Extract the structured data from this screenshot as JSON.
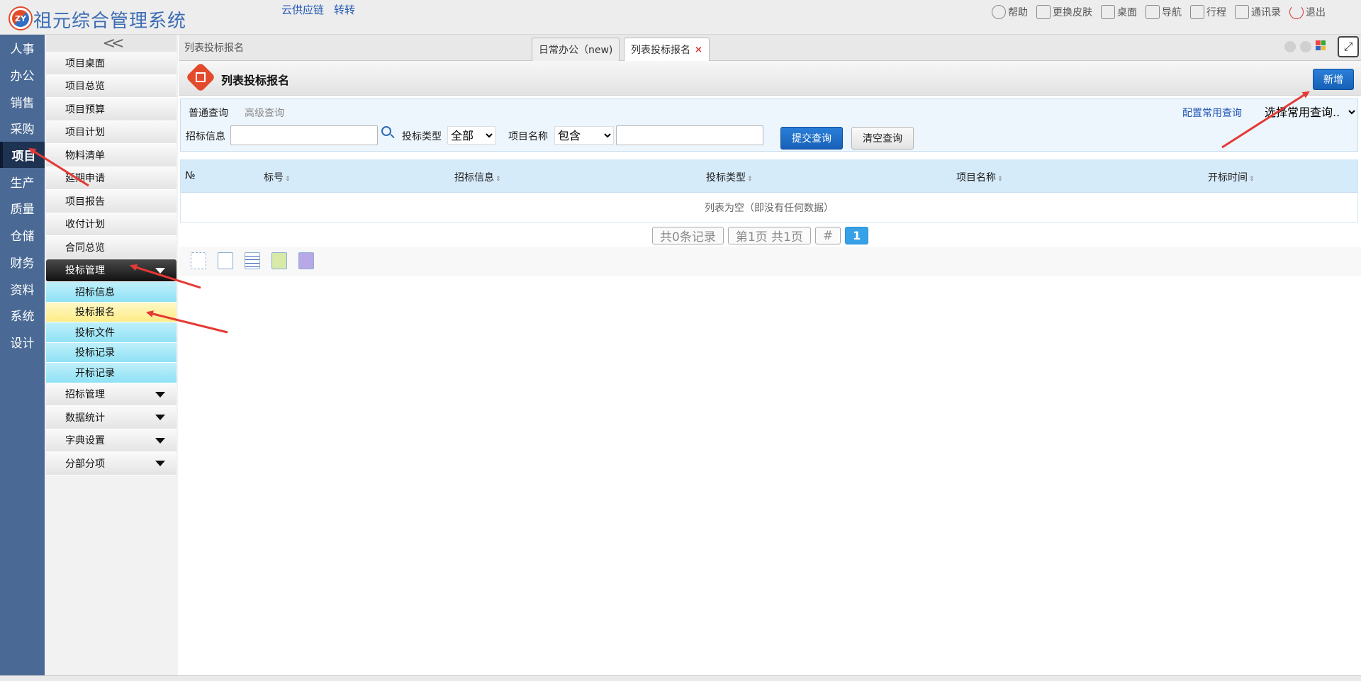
{
  "app": {
    "logo_text": "ZY",
    "title": "祖元综合管理系统",
    "top_links": [
      "云供应链",
      "转转"
    ],
    "top_right": [
      {
        "label": "帮助",
        "icon": "help-icon"
      },
      {
        "label": "更换皮肤",
        "icon": "shirt-icon"
      },
      {
        "label": "桌面",
        "icon": "home-icon"
      },
      {
        "label": "导航",
        "icon": "grid-nav-icon"
      },
      {
        "label": "行程",
        "icon": "calendar-icon"
      },
      {
        "label": "通讯录",
        "icon": "contacts-icon"
      },
      {
        "label": "退出",
        "icon": "power-icon"
      }
    ]
  },
  "modules": [
    "人事",
    "办公",
    "销售",
    "采购",
    "项目",
    "生产",
    "质量",
    "仓储",
    "财务",
    "资料",
    "系统",
    "设计"
  ],
  "active_module": "项目",
  "menu": {
    "collapse_glyph": "<<",
    "items": [
      "项目桌面",
      "项目总览",
      "项目预算",
      "项目计划",
      "物料清单",
      "延期申请",
      "项目报告",
      "收付计划",
      "合同总览"
    ],
    "expanded_group": "投标管理",
    "sub_items": [
      "招标信息",
      "投标报名",
      "投标文件",
      "投标记录",
      "开标记录"
    ],
    "selected_sub": "投标报名",
    "groups": [
      "招标管理",
      "数据统计",
      "字典设置",
      "分部分项"
    ]
  },
  "breadcrumb": "列表投标报名",
  "tabs": [
    {
      "label": "日常办公（new)",
      "active": false
    },
    {
      "label": "列表投标报名",
      "active": true,
      "close": "×"
    }
  ],
  "page": {
    "title": "列表投标报名",
    "add_button": "新增"
  },
  "query": {
    "tab_normal": "普通查询",
    "tab_advanced": "高级查询",
    "config_link": "配置常用查询",
    "saved_select": "选择常用查询..",
    "label_bid_info": "招标信息",
    "bid_info_value": "",
    "label_bid_type": "投标类型",
    "bid_type_value": "全部",
    "label_project_name": "项目名称",
    "project_op_value": "包含",
    "project_name_value": "",
    "submit": "提交查询",
    "clear": "清空查询"
  },
  "grid": {
    "columns": [
      "№",
      "标号",
      "招标信息",
      "投标类型",
      "项目名称",
      "开标时间"
    ],
    "sort_glyph": "⇕",
    "empty_text": "列表为空（即没有任何数据）"
  },
  "pager": {
    "total": "共0条记录",
    "page_info": "第1页 共1页",
    "hash": "#",
    "current": "1"
  },
  "toolbar_icons": [
    "select-icon",
    "document-icon",
    "table-icon",
    "edit-icon",
    "puzzle-icon"
  ],
  "colors": {
    "module_strip": "#4a6a95",
    "primary_button": "#1760b8",
    "sub_menu": "#8fe1f5",
    "selected_sub_menu": "#fdec86",
    "grid_header": "#d6ebfa",
    "annotation_arrow": "#e53935"
  }
}
